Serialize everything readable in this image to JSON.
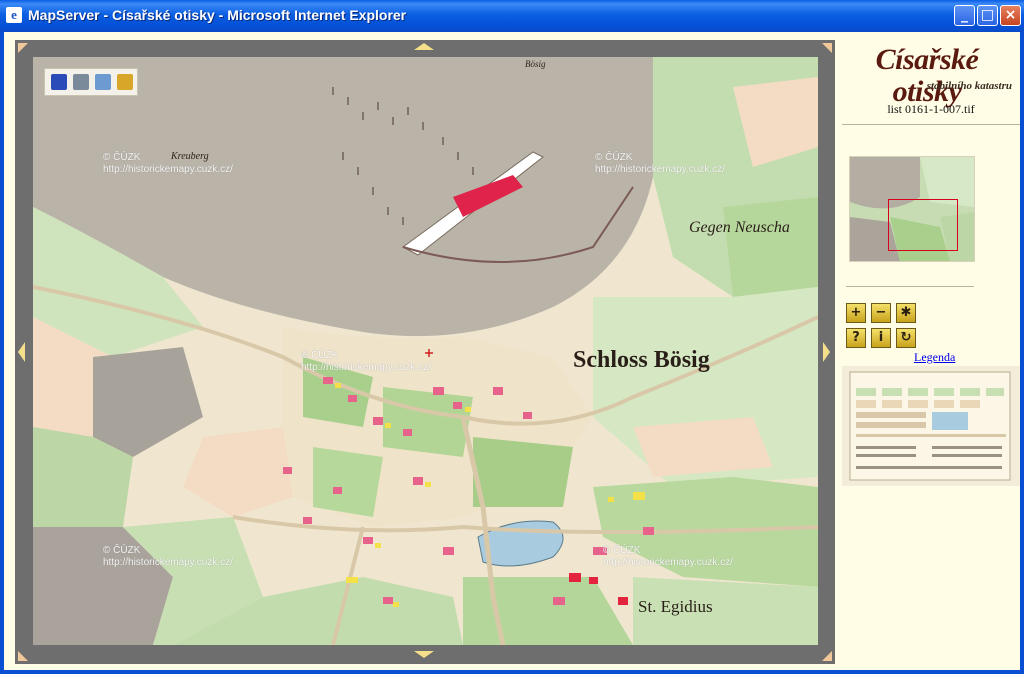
{
  "window": {
    "title": "MapServer - Císařské otisky - Microsoft Internet Explorer",
    "app_icon": "ie-page-icon",
    "buttons": {
      "minimize": "_",
      "maximize": "□",
      "close": "×"
    }
  },
  "toolbar": {
    "icons": [
      "save-icon",
      "print-icon",
      "email-icon",
      "export-icon"
    ]
  },
  "map": {
    "watermarks": [
      {
        "line1": "© ČÚZK",
        "line2": "http://historickemapy.cuzk.cz/"
      },
      {
        "line1": "© ČÚZK",
        "line2": "http://historickemapy.cuzk.cz/"
      },
      {
        "line1": "© ČÚZK",
        "line2": "http://historickemapy.cuzk.cz/"
      },
      {
        "line1": "© ČÚZK",
        "line2": "http://historickemapy.cuzk.cz/"
      },
      {
        "line1": "© ČÚZK",
        "line2": "http://historickemapy.cuzk.cz/"
      },
      {
        "line1": "© ČÚZK",
        "line2": "http://historickemapy.cuzk.cz/"
      }
    ],
    "labels": {
      "castle": "Schloss Bösig",
      "village": "St. Egidius",
      "east": "Gegen Neuscha",
      "hill": "Kreuberg",
      "top": "Bösig"
    },
    "colors": {
      "grey": "#b9b3a8",
      "green": "#bcd7a5",
      "cream": "#f1e7cf",
      "red": "#e4233f",
      "yellow": "#f3e047"
    }
  },
  "panel": {
    "logo_title": "Císařské otisky",
    "logo_subtitle": "stabilního katastru",
    "sheet_name": "list 0161-1-007.tif",
    "nav_buttons": [
      {
        "name": "zoom-in",
        "glyph": "+"
      },
      {
        "name": "zoom-out",
        "glyph": "−"
      },
      {
        "name": "full-extent",
        "glyph": "✱"
      },
      {
        "name": "help",
        "glyph": "?"
      },
      {
        "name": "info",
        "glyph": "i"
      },
      {
        "name": "refresh",
        "glyph": "↻"
      }
    ],
    "legend_link": "Legenda"
  }
}
